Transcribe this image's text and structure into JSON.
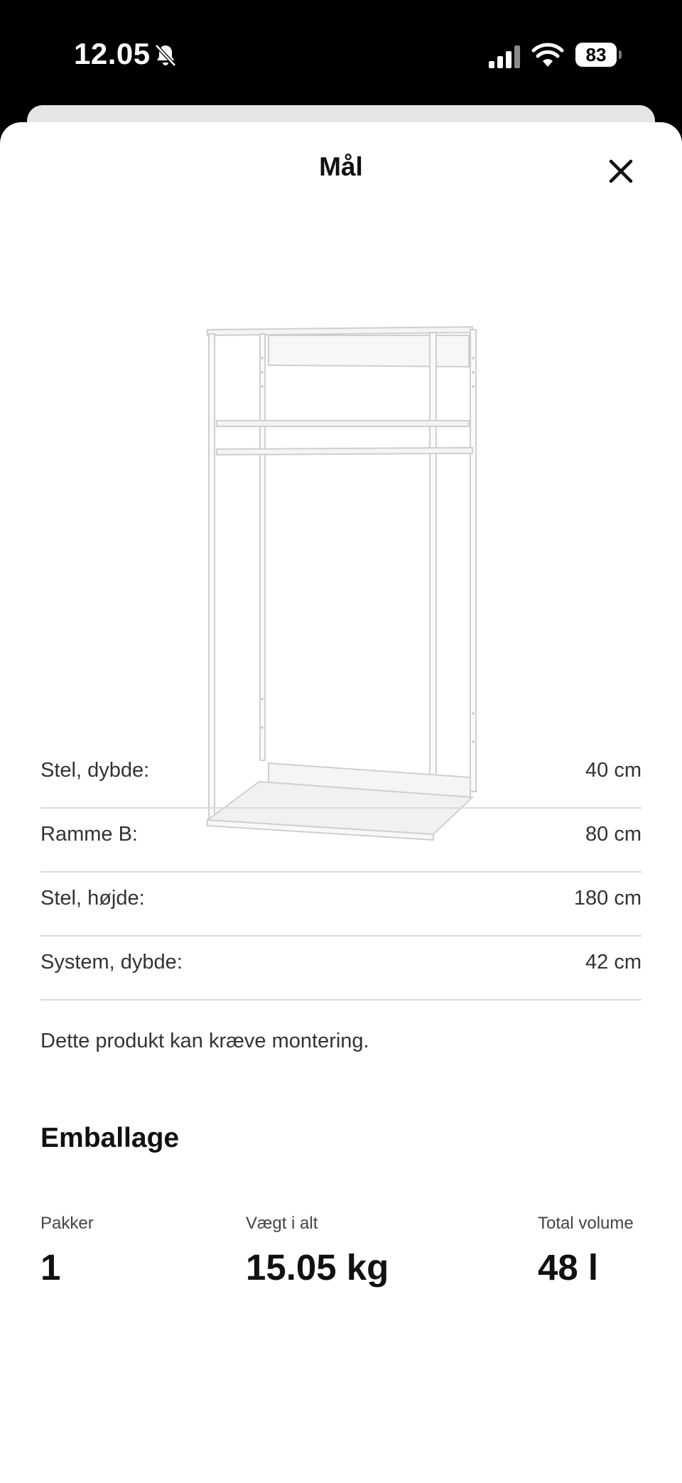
{
  "status_bar": {
    "time": "12.05",
    "battery": "83",
    "icons": [
      "bell-slash-icon",
      "cellular-signal-icon",
      "wifi-icon",
      "battery-icon"
    ]
  },
  "sheet": {
    "title": "Mål",
    "close_icon": "close-icon"
  },
  "product_image": {
    "description_icon": "open-wardrobe-frame"
  },
  "specs": [
    {
      "label": "Stel, dybde:",
      "value": "40 cm"
    },
    {
      "label": "Ramme B:",
      "value": "80 cm"
    },
    {
      "label": "Stel, højde:",
      "value": "180 cm"
    },
    {
      "label": "System, dybde:",
      "value": "42 cm"
    }
  ],
  "assembly_note": "Dette produkt kan kræve montering.",
  "packaging": {
    "heading": "Emballage",
    "packages_label": "Pakker",
    "packages_value": "1",
    "weight_label": "Vægt i alt",
    "weight_value": "15.05 kg",
    "volume_label": "Total volume",
    "volume_value": "48 l"
  },
  "colors": {
    "background": "#ffffff",
    "status_bar": "#000000",
    "divider": "#dadada",
    "text": "#111111"
  }
}
